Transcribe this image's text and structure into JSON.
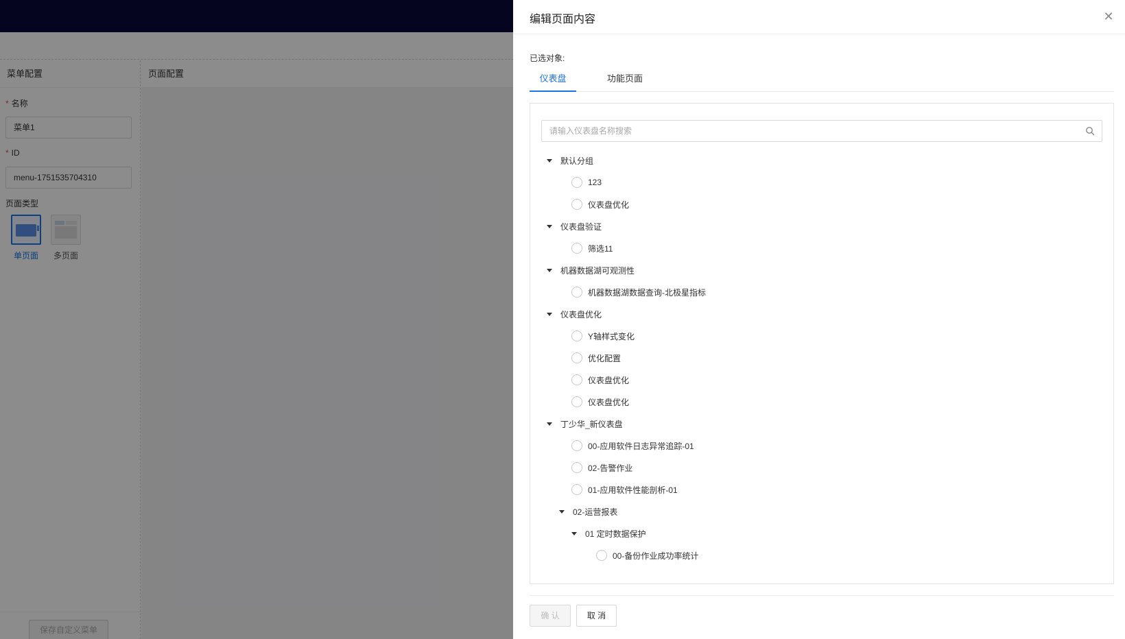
{
  "menu_config": {
    "title": "菜单配置",
    "name_label": "名称",
    "name_value": "菜单1",
    "id_label": "ID",
    "id_value": "menu-1751535704310",
    "page_type_label": "页面类型",
    "page_types": [
      "单页面",
      "多页面"
    ],
    "save_button": "保存自定义菜单"
  },
  "page_config": {
    "title": "页面配置"
  },
  "drawer": {
    "title": "编辑页面内容",
    "selected_label": "已选对象:",
    "tabs": [
      "仪表盘",
      "功能页面"
    ],
    "search_placeholder": "请输入仪表盘名称搜索",
    "tree": [
      {
        "type": "group",
        "label": "默认分组",
        "depth": 0
      },
      {
        "type": "leaf",
        "label": "123",
        "depth": 0
      },
      {
        "type": "leaf",
        "label": "仪表盘优化",
        "depth": 0
      },
      {
        "type": "group",
        "label": "仪表盘验证",
        "depth": 0
      },
      {
        "type": "leaf",
        "label": "筛选11",
        "depth": 0
      },
      {
        "type": "group",
        "label": "机器数据湖可观测性",
        "depth": 0
      },
      {
        "type": "leaf",
        "label": "机器数据湖数据查询-北极星指标",
        "depth": 0
      },
      {
        "type": "group",
        "label": "仪表盘优化",
        "depth": 0
      },
      {
        "type": "leaf",
        "label": "Y轴样式变化",
        "depth": 0
      },
      {
        "type": "leaf",
        "label": "优化配置",
        "depth": 0
      },
      {
        "type": "leaf",
        "label": "仪表盘优化",
        "depth": 0
      },
      {
        "type": "leaf",
        "label": "仪表盘优化",
        "depth": 0
      },
      {
        "type": "group",
        "label": "丁少华_新仪表盘",
        "depth": 0
      },
      {
        "type": "leaf",
        "label": "00-应用软件日志异常追踪-01",
        "depth": 0
      },
      {
        "type": "leaf",
        "label": "02-告警作业",
        "depth": 0
      },
      {
        "type": "leaf",
        "label": "01-应用软件性能剖析-01",
        "depth": 0
      },
      {
        "type": "group",
        "label": "02-运营报表",
        "depth": 1
      },
      {
        "type": "group",
        "label": "01 定时数据保护",
        "depth": 2
      },
      {
        "type": "leaf",
        "label": "00-备份作业成功率统计",
        "depth": 2
      }
    ],
    "confirm": "确 认",
    "cancel": "取 消"
  }
}
